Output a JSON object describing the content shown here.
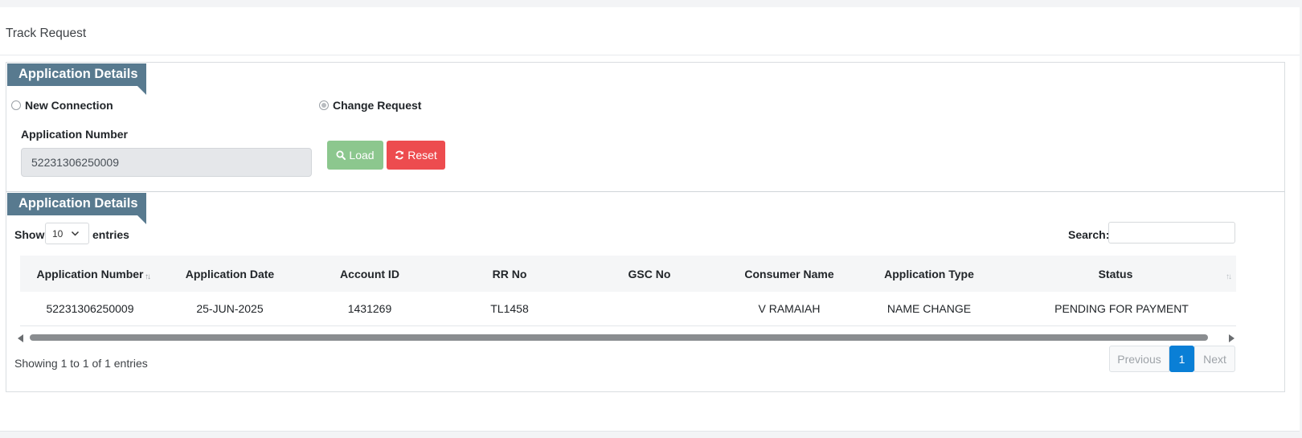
{
  "page": {
    "title": "Track Request"
  },
  "search_panel": {
    "ribbon_title": "Application Details",
    "radios": [
      {
        "label": "New Connection",
        "checked": false
      },
      {
        "label": "Change Request",
        "checked": true
      }
    ],
    "application_number_label": "Application Number",
    "application_number_value": "52231306250009",
    "load_label": "Load",
    "reset_label": "Reset"
  },
  "results_panel": {
    "ribbon_title": "Application Details",
    "show_label": "Show",
    "length_value": "10",
    "entries_label": "entries",
    "search_label": "Search:",
    "columns": [
      "Application Number",
      "Application Date",
      "Account ID",
      "RR No",
      "GSC No",
      "Consumer Name",
      "Application Type",
      "Status"
    ],
    "rows": [
      [
        "52231306250009",
        "25-JUN-2025",
        "1431269",
        "TL1458",
        "",
        "V RAMAIAH",
        "NAME CHANGE",
        "PENDING FOR PAYMENT"
      ]
    ],
    "info": "Showing 1 to 1 of 1 entries",
    "pagination": {
      "previous": "Previous",
      "current": "1",
      "next": "Next"
    }
  },
  "colors": {
    "ribbon": "#587a8f",
    "load_button": "#8cc78e",
    "reset_button": "#ed4c4f",
    "active_page": "#0a7fd6"
  },
  "icons": {
    "load": "search-icon",
    "reset": "refresh-icon",
    "length_select": "chevron-down-icon",
    "sort": "sort-arrows-icon"
  }
}
